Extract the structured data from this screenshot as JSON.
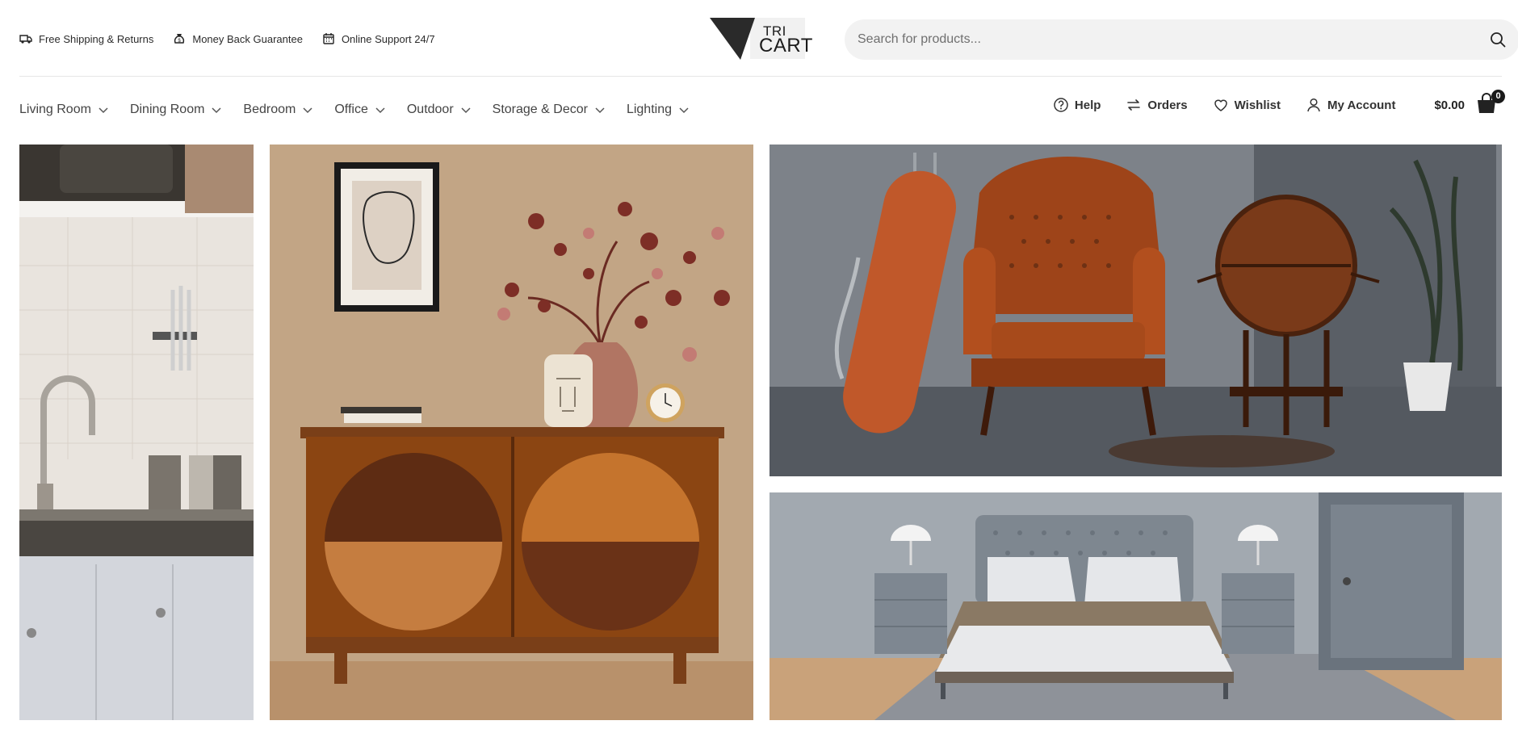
{
  "header": {
    "perks": [
      {
        "icon": "truck-icon",
        "label": "Free Shipping & Returns"
      },
      {
        "icon": "money-bag-icon",
        "label": "Money Back Guarantee"
      },
      {
        "icon": "calendar-icon",
        "label": "Online Support 24/7"
      }
    ],
    "logo": {
      "line1": "TRI",
      "line2": "CART"
    },
    "search": {
      "placeholder": "Search for products..."
    }
  },
  "nav": {
    "categories": [
      "Living Room",
      "Dining Room",
      "Bedroom",
      "Office",
      "Outdoor",
      "Storage & Decor",
      "Lighting"
    ],
    "utilities": [
      {
        "icon": "help-icon",
        "label": "Help"
      },
      {
        "icon": "orders-icon",
        "label": "Orders"
      },
      {
        "icon": "heart-icon",
        "label": "Wishlist"
      },
      {
        "icon": "user-icon",
        "label": "My Account"
      }
    ],
    "cart": {
      "total": "$0.00",
      "count": "0"
    }
  },
  "colors": {
    "accent": "#2b2b2b",
    "search_bg": "#f2f2f2",
    "border": "#e6e6e6"
  },
  "banners": [
    {
      "name": "kitchen-banner",
      "scene": "kitchen"
    },
    {
      "name": "sideboard-banner",
      "scene": "sideboard"
    },
    {
      "name": "armchair-banner",
      "scene": "armchair"
    },
    {
      "name": "bedroom-banner",
      "scene": "bedroom"
    }
  ]
}
